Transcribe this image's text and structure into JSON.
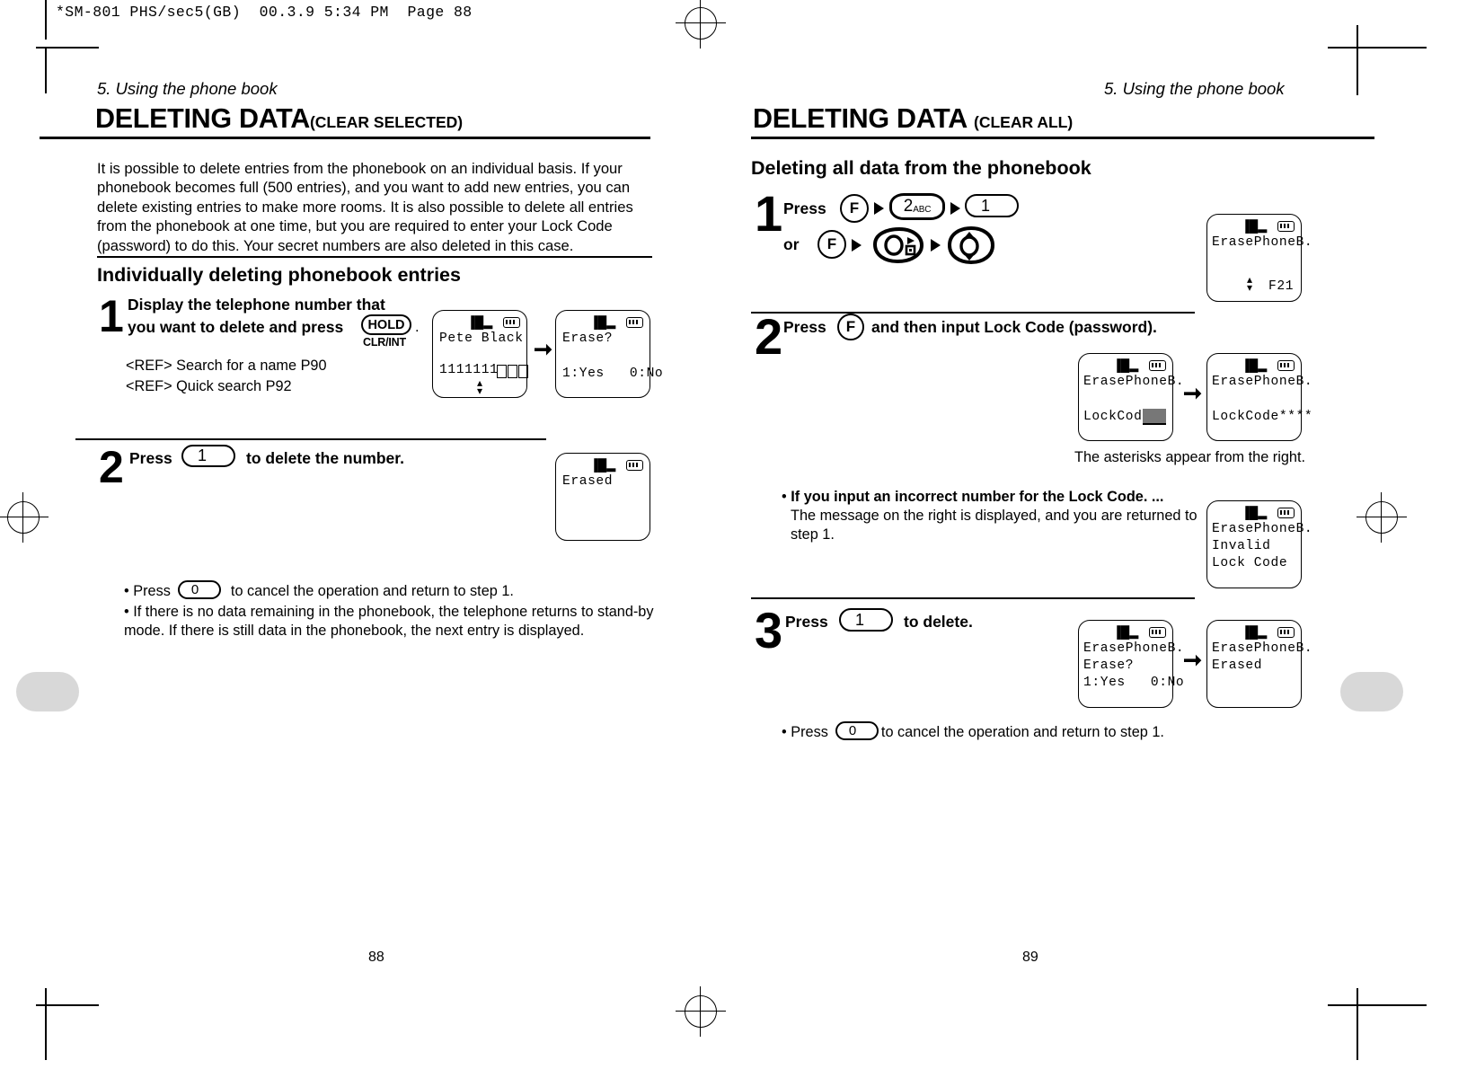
{
  "file_header": "*SM-801 PHS/sec5(GB)  00.3.9 5:34 PM  Page 88",
  "left_page": {
    "running_head": "5. Using the phone book",
    "title": "DELETING DATA",
    "title_sub": "(CLEAR SELECTED)",
    "intro": "It is possible to delete entries from the phonebook on an individual basis. If your phonebook becomes full (500 entries), and you want to add new entries, you can delete existing entries to make more rooms. It is also possible to delete all entries from the phonebook at one time, but you are required to enter your Lock Code (password) to do this. Your secret numbers are also deleted in this case.",
    "section_heading": "Individually deleting phonebook entries",
    "step1": {
      "num": "1",
      "text_line1": "Display the telephone number that",
      "text_line2": "you want to delete and press",
      "key_hold": "HOLD",
      "key_hold_sub": "CLR/INT",
      "period": ".",
      "ref1": "<REF> Search for a name P90",
      "ref2": "<REF> Quick search P92",
      "lcd1": {
        "line1": "Pete Black",
        "line2": "1111111",
        "boxes": 4,
        "scroll": "↕"
      },
      "lcd2": {
        "line1": "Erase?",
        "line2": "1:Yes   0:No"
      }
    },
    "step2": {
      "num": "2",
      "press_label": "Press",
      "key": "1",
      "tail": "to delete the number.",
      "lcd": {
        "line1": "Erased"
      }
    },
    "bullets": [
      {
        "pre": "Press",
        "key": "0",
        "post": "to cancel the operation and return to step 1."
      },
      {
        "text": "If there is no data remaining in the phonebook, the telephone returns to stand-by mode. If there is still data in the phonebook, the next entry is displayed."
      }
    ],
    "page_number": "88"
  },
  "right_page": {
    "running_head": "5. Using the phone book",
    "title": "DELETING DATA",
    "title_sub": "(CLEAR ALL)",
    "section_heading": "Deleting all data from the phonebook",
    "step1": {
      "num": "1",
      "press_label": "Press",
      "or_label": "or",
      "keys_row1": [
        "F",
        "2ABC",
        "1"
      ],
      "key2_digit": "2",
      "key2_letters": "ABC",
      "keys_row2": [
        "F",
        "O-menu",
        "O-updown"
      ],
      "lcd": {
        "line1": "ErasePhoneB.",
        "line2": "F21",
        "scroll": "updown"
      }
    },
    "step2": {
      "num": "2",
      "press_label": "Press",
      "key": "F",
      "tail": "and then input Lock Code (password).",
      "lcd1": {
        "line1": "ErasePhoneB.",
        "line2": "LockCode",
        "cursor": true
      },
      "lcd2": {
        "line1": "ErasePhoneB.",
        "line2": "LockCode****"
      },
      "caption": "The asterisks appear from the right."
    },
    "bullet_invalid": {
      "bold": "If you input an incorrect number for the Lock Code. ...",
      "text": "The message on the right is displayed, and you are returned to step 1.",
      "lcd": {
        "line1": "ErasePhoneB.",
        "line2": "Invalid",
        "line3": "Lock Code"
      }
    },
    "step3": {
      "num": "3",
      "press_label": "Press",
      "key": "1",
      "tail": "to delete.",
      "lcd1": {
        "line1": "ErasePhoneB.",
        "line2": "Erase?",
        "line3": "1:Yes   0:No"
      },
      "lcd2": {
        "line1": "ErasePhoneB.",
        "line2": "Erased"
      }
    },
    "bullet_cancel": {
      "pre": "Press",
      "key": "0",
      "post": "to cancel the operation and return to step 1."
    },
    "page_number": "89"
  }
}
